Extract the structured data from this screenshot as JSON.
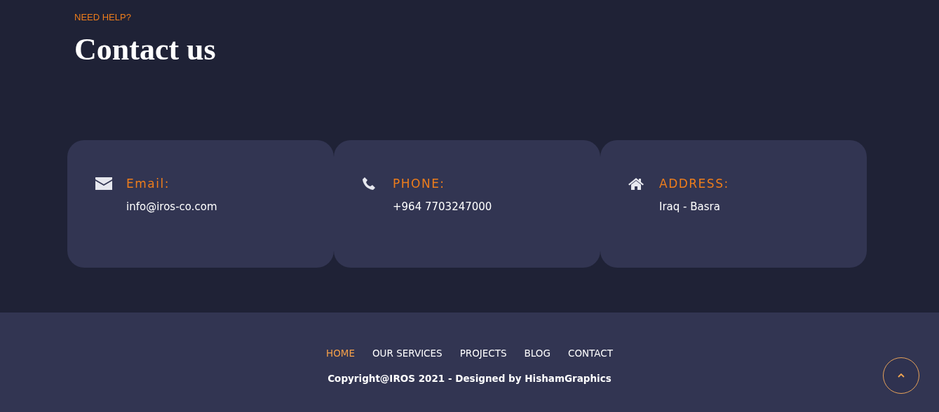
{
  "section": {
    "eyebrow": "NEED HELP?",
    "title": "Contact us"
  },
  "cards": [
    {
      "kind": "email",
      "label": "Email:",
      "value": "info@iros-co.com"
    },
    {
      "kind": "phone",
      "label": "PHONE:",
      "value": "+964 7703247000"
    },
    {
      "kind": "address",
      "label": "ADDRESS:",
      "value": "Iraq - Basra"
    }
  ],
  "footer": {
    "nav": [
      {
        "label": "HOME",
        "selected": true
      },
      {
        "label": "OUR SERVICES",
        "selected": false
      },
      {
        "label": "PROJECTS",
        "selected": false
      },
      {
        "label": "BLOG",
        "selected": false
      },
      {
        "label": "CONTACT",
        "selected": false
      }
    ],
    "copyright": "Copyright@IROS 2021 - Designed by HishamGraphics"
  }
}
